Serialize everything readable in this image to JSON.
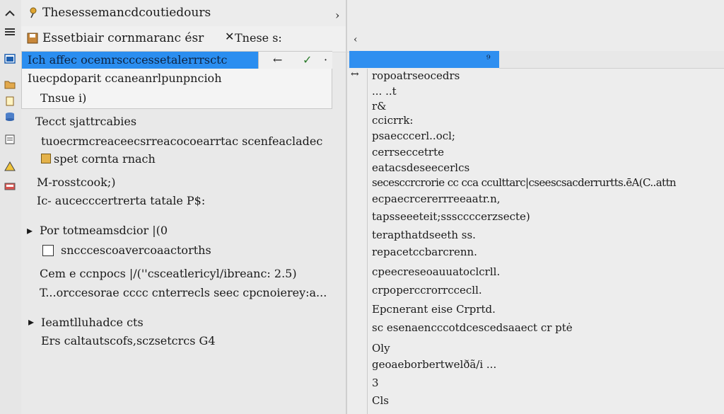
{
  "left": {
    "title": "Thesessemancdcoutiedours",
    "subtitle": "Essetbiair cornmaranc ésr",
    "subtitle_right": "Tnese s:",
    "popup": {
      "selected": "Ich affec ocemrscccessetalerrrsctc",
      "item2": "Iuecpdoparit ccaneanrlpunpncioh",
      "item3": "Tnsue i)"
    },
    "lines": [
      "Tecct sjattrcabies",
      "tuoecrmcreaceecsrreacocoearrtac scenfeacladec",
      "spet cornta rnach",
      "M-rosstcook;)",
      "Ic- aucecccertrerta tatale P$:",
      "Por totmeamsdcior |(0",
      "sncccescoavercoaactorths",
      "Cem e ccnpocs |/(''csceatlericyl/ibreanc: 2.5)",
      "T...orccesorae cccc cnterrecls seec cpcnoierey:a...",
      "Ieamtlluhadce cts",
      "Ers caltautscofs,sczsetcrcs G4"
    ]
  },
  "right": {
    "lines": [
      "ropoatrseocedrs",
      "... ..t",
      "r&",
      "ccicrrk:",
      "psaecccerl..ocl;",
      "cerrseccetrte",
      "eatacsdeseecerlcs",
      "secesccrcrorie cc cca cculttarc|cseescsacderrurtts.ēA(C..attn",
      "ecpaecrcererrreeaatr.n,",
      "tapsseeeteit;sssccccerzsecte)",
      "terapthatdseeth ss.",
      "repacetccbarcrenn.",
      "cpeecreseoauuatoclcrll.",
      "crpoperccrorrccecll.",
      "Epcnerant eise Crprtd.",
      "sc esenaencccotdcescedsaaect cr ptė",
      "Oly",
      "geoaeborbertwelðã/i ...",
      "3",
      "Cls"
    ]
  }
}
